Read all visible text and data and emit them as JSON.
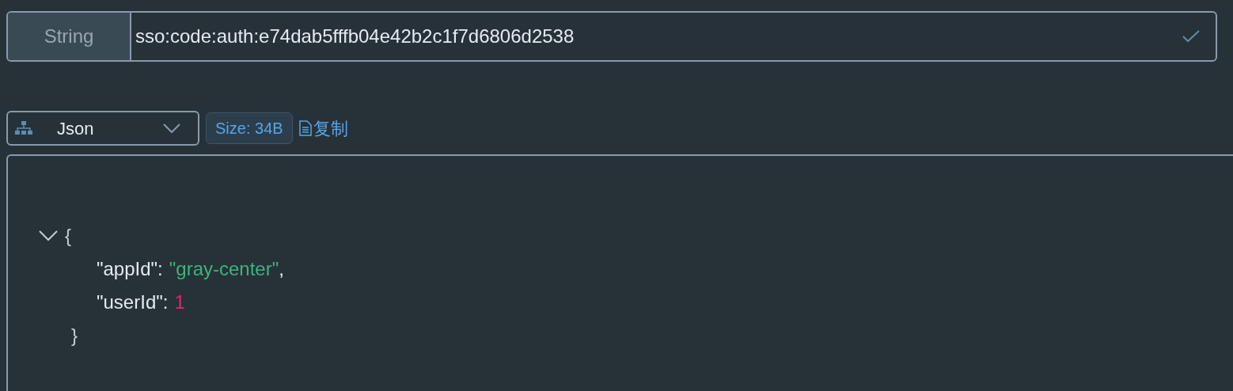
{
  "key_bar": {
    "type_label": "String",
    "key_value": "sso:code:auth:e74dab5fffb04e42b2c1f7d6806d2538"
  },
  "toolbar": {
    "format": "Json",
    "size_badge": "Size: 34B",
    "copy_link": "复制"
  },
  "editor": {
    "expanded": true,
    "open": "{",
    "close": "}",
    "entries": [
      {
        "key": "\"appId\"",
        "colon": ":",
        "value": "\"gray-center\"",
        "kind": "string",
        "comma": ","
      },
      {
        "key": "\"userId\"",
        "colon": ":",
        "value": "1",
        "kind": "number"
      }
    ]
  }
}
